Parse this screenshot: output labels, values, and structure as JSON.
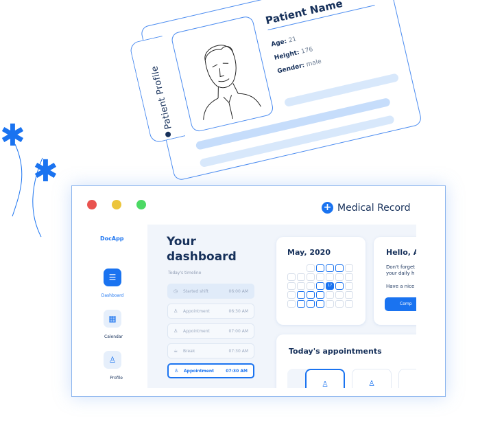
{
  "patient_profile": {
    "tab_label": "Patient Profile",
    "name": "Patient Name",
    "age_label": "Age:",
    "age_value": "21",
    "height_label": "Height:",
    "height_value": "176",
    "gender_label": "Gender:",
    "gender_value": "male"
  },
  "window": {
    "traffic_lights": [
      "#e9534f",
      "#ecc53c",
      "#4cd964"
    ],
    "medical_record_label": "Medical Record"
  },
  "sidebar": {
    "brand": "DocApp",
    "items": [
      {
        "label": "Dashboard",
        "icon": "document-icon",
        "active": true
      },
      {
        "label": "Calendar",
        "icon": "calendar-icon",
        "active": false
      },
      {
        "label": "Profile",
        "icon": "user-icon",
        "active": false
      }
    ]
  },
  "dashboard": {
    "title_line1": "Your",
    "title_line2": "dashboard",
    "timeline_label": "Today's timeline",
    "timeline": [
      {
        "name": "Started shift",
        "time": "06:00 AM",
        "icon": "clock-icon",
        "state": "highlight"
      },
      {
        "name": "Appointment",
        "time": "06:30 AM",
        "icon": "user-icon",
        "state": "normal"
      },
      {
        "name": "Appointment",
        "time": "07:00 AM",
        "icon": "user-icon",
        "state": "normal"
      },
      {
        "name": "Break",
        "time": "07:30 AM",
        "icon": "coffee-icon",
        "state": "normal"
      },
      {
        "name": "Appointment",
        "time": "07:30 AM",
        "icon": "user-icon",
        "state": "active"
      }
    ]
  },
  "calendar": {
    "month": "May, 2020",
    "selected_day": "17"
  },
  "greeting": {
    "title": "Hello, A",
    "line1": "Don't forget",
    "line2": "your daily h",
    "line3": "Have a nice",
    "button": "Comp"
  },
  "appointments": {
    "title": "Today's appointments"
  },
  "colors": {
    "accent": "#1a73f0",
    "navy": "#16305a"
  }
}
